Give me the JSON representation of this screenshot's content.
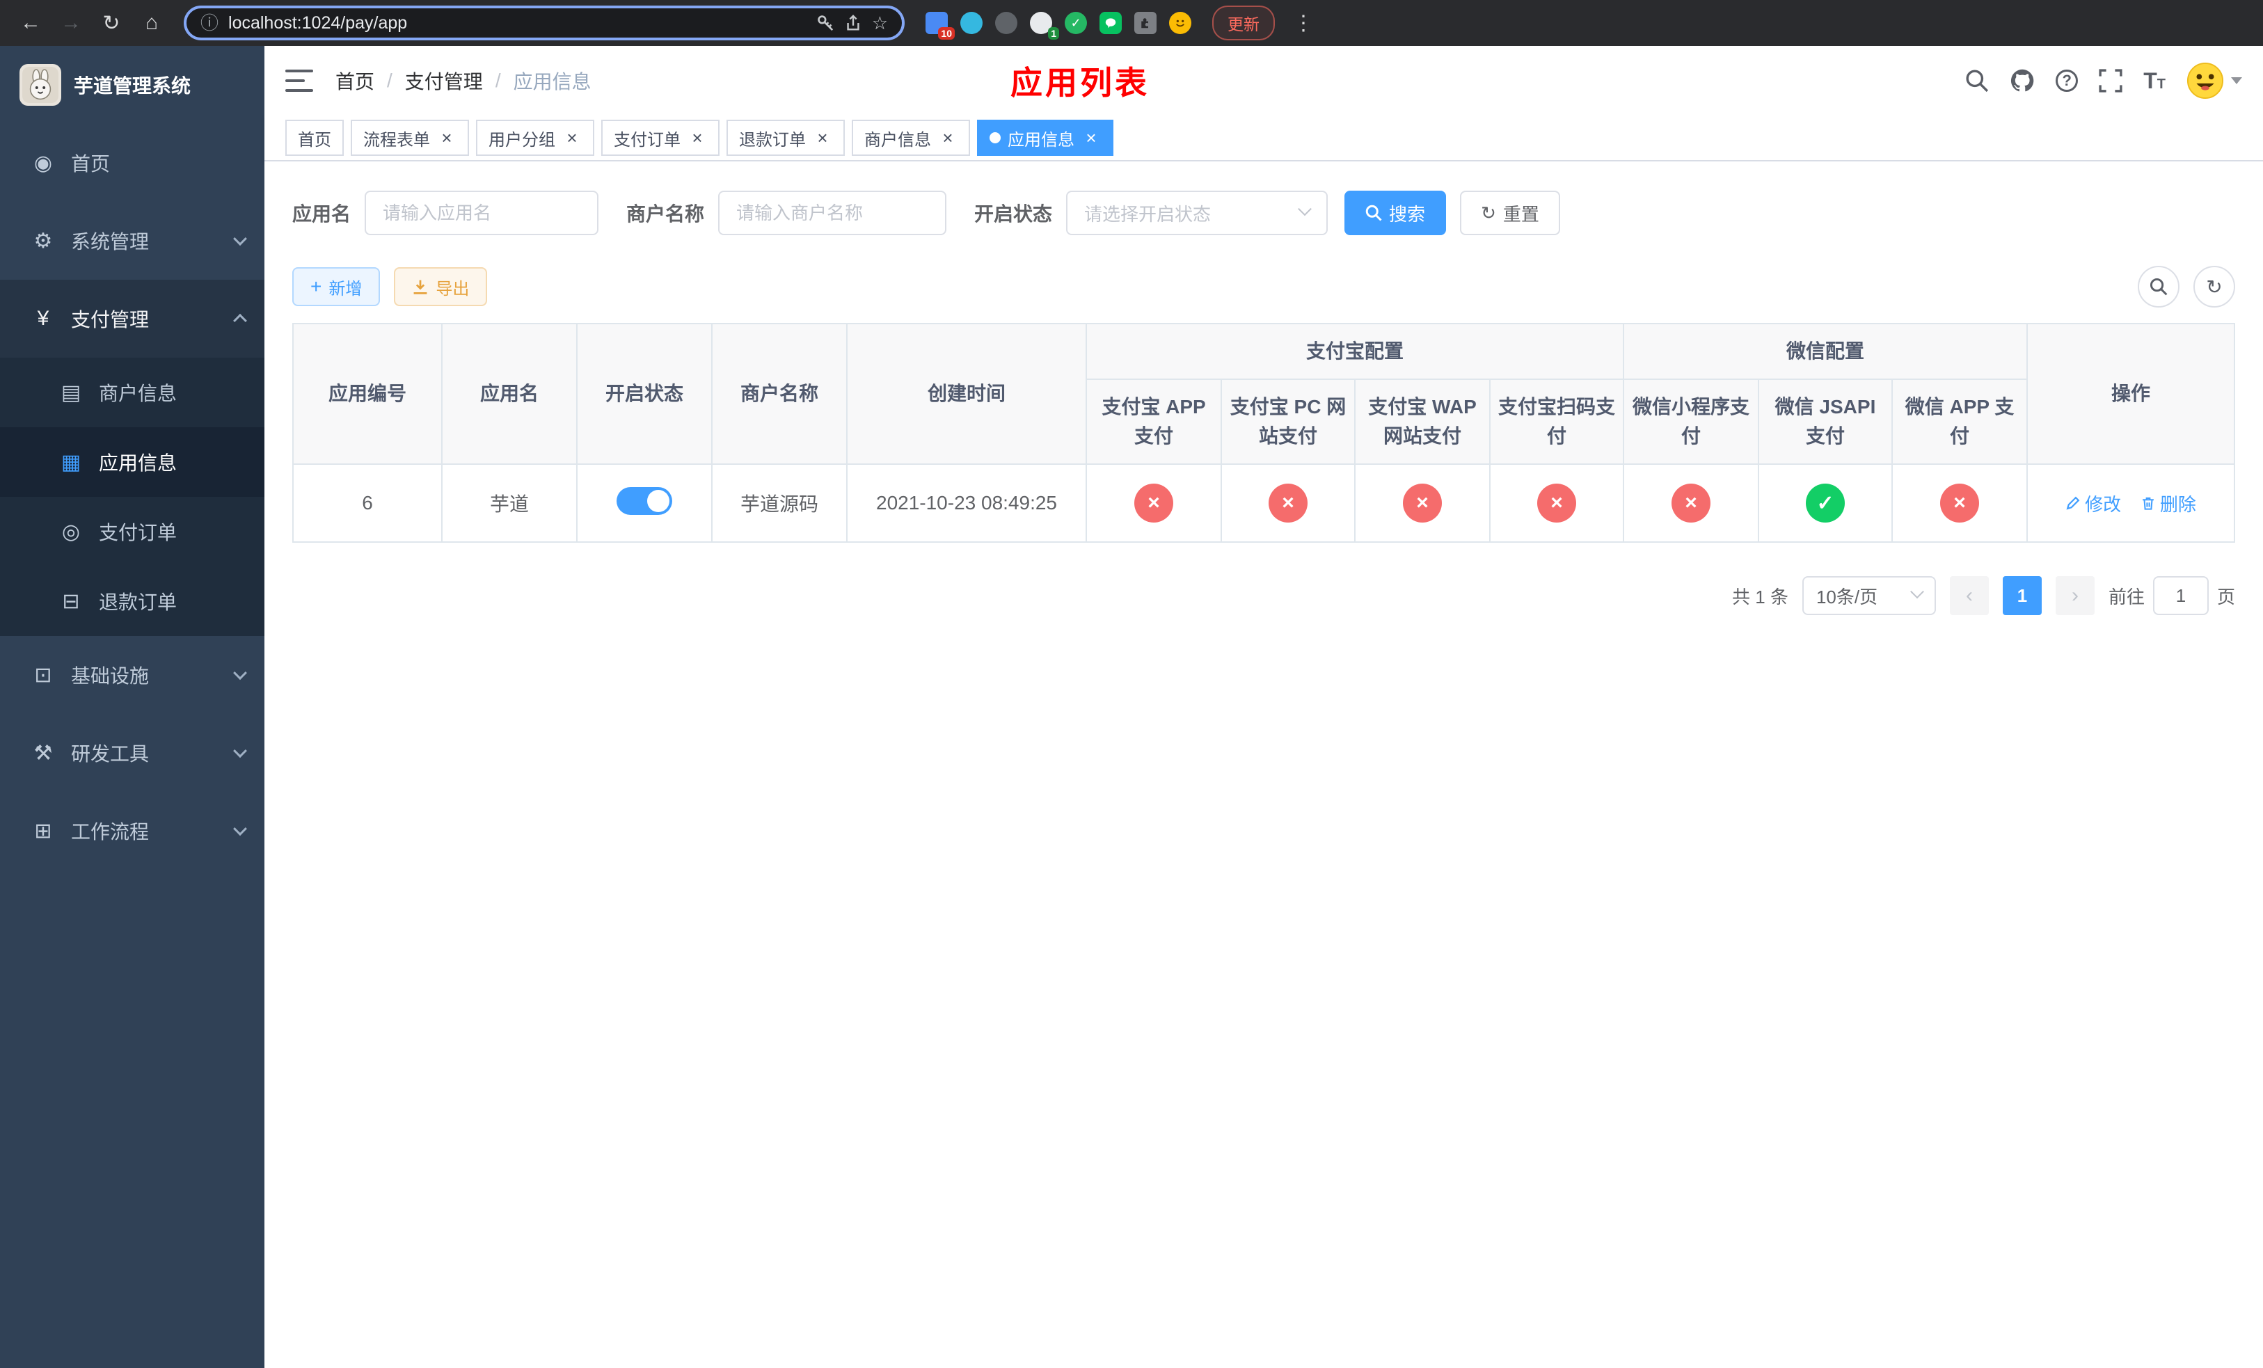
{
  "browser": {
    "url": "localhost:1024/pay/app",
    "update_label": "更新",
    "extension_badges": {
      "puzzle_badge": "10",
      "reader_badge": "1"
    }
  },
  "sidebar": {
    "title": "芋道管理系统",
    "items": [
      {
        "key": "home",
        "label": "首页",
        "icon": "dashboard-icon"
      },
      {
        "key": "system",
        "label": "系统管理",
        "icon": "gear-icon",
        "children": true,
        "expanded": false
      },
      {
        "key": "payment",
        "label": "支付管理",
        "icon": "yen-icon",
        "children": true,
        "expanded": true,
        "sub": [
          {
            "key": "merchant-info",
            "label": "商户信息",
            "icon": "card-icon",
            "active": false
          },
          {
            "key": "app-info",
            "label": "应用信息",
            "icon": "grid-icon",
            "active": true
          },
          {
            "key": "pay-order",
            "label": "支付订单",
            "icon": "order-icon",
            "active": false
          },
          {
            "key": "refund-order",
            "label": "退款订单",
            "icon": "refund-icon",
            "active": false
          }
        ]
      },
      {
        "key": "infra",
        "label": "基础设施",
        "icon": "infra-icon",
        "children": true,
        "expanded": false
      },
      {
        "key": "devtools",
        "label": "研发工具",
        "icon": "tools-icon",
        "children": true,
        "expanded": false
      },
      {
        "key": "workflow",
        "label": "工作流程",
        "icon": "workflow-icon",
        "children": true,
        "expanded": false
      }
    ]
  },
  "navbar": {
    "breadcrumb": {
      "0": "首页",
      "1": "支付管理",
      "2": "应用信息"
    },
    "page_title": "应用列表",
    "icons": [
      "search-icon",
      "github-icon",
      "question-icon",
      "fullscreen-icon",
      "font-size-icon",
      "avatar"
    ]
  },
  "tabs": [
    {
      "key": "home",
      "label": "首页",
      "closable": false,
      "active": false
    },
    {
      "key": "process-form",
      "label": "流程表单",
      "closable": true,
      "active": false
    },
    {
      "key": "user-group",
      "label": "用户分组",
      "closable": true,
      "active": false
    },
    {
      "key": "pay-order",
      "label": "支付订单",
      "closable": true,
      "active": false
    },
    {
      "key": "refund-order",
      "label": "退款订单",
      "closable": true,
      "active": false
    },
    {
      "key": "merchant-info",
      "label": "商户信息",
      "closable": true,
      "active": false
    },
    {
      "key": "app-info",
      "label": "应用信息",
      "closable": true,
      "active": true
    }
  ],
  "filters": {
    "app_name_label": "应用名",
    "app_name_placeholder": "请输入应用名",
    "merchant_label": "商户名称",
    "merchant_placeholder": "请输入商户名称",
    "status_label": "开启状态",
    "status_placeholder": "请选择开启状态",
    "search_label": "搜索",
    "reset_label": "重置"
  },
  "toolbar": {
    "add_label": "新增",
    "export_label": "导出"
  },
  "table": {
    "group_headers": {
      "alipay": "支付宝配置",
      "wechat": "微信配置"
    },
    "columns": [
      "应用编号",
      "应用名",
      "开启状态",
      "商户名称",
      "创建时间",
      "支付宝 APP 支付",
      "支付宝 PC 网站支付",
      "支付宝 WAP 网站支付",
      "支付宝扫码支付",
      "微信小程序支付",
      "微信 JSAPI 支付",
      "微信 APP 支付",
      "操作"
    ],
    "rows": [
      {
        "id": "6",
        "name": "芋道",
        "enabled": true,
        "merchant": "芋道源码",
        "created": "2021-10-23 08:49:25",
        "alipay_app": false,
        "alipay_pc": false,
        "alipay_wap": false,
        "alipay_qr": false,
        "wx_mini": false,
        "wx_jsapi": true,
        "wx_app": false,
        "edit_label": "修改",
        "delete_label": "删除"
      }
    ]
  },
  "pagination": {
    "total_label": "共 1 条",
    "page_size": "10条/页",
    "prev": "‹",
    "next": "›",
    "current_page": "1",
    "goto_label": "前往",
    "goto_value": "1",
    "page_suffix": "页"
  },
  "colors": {
    "accent": "#409EFF",
    "danger": "#F56C6C",
    "success": "#13ce66",
    "title_red": "#FF0000",
    "sidebar_bg": "#304156",
    "submenu_bg": "#1f2d3d"
  }
}
